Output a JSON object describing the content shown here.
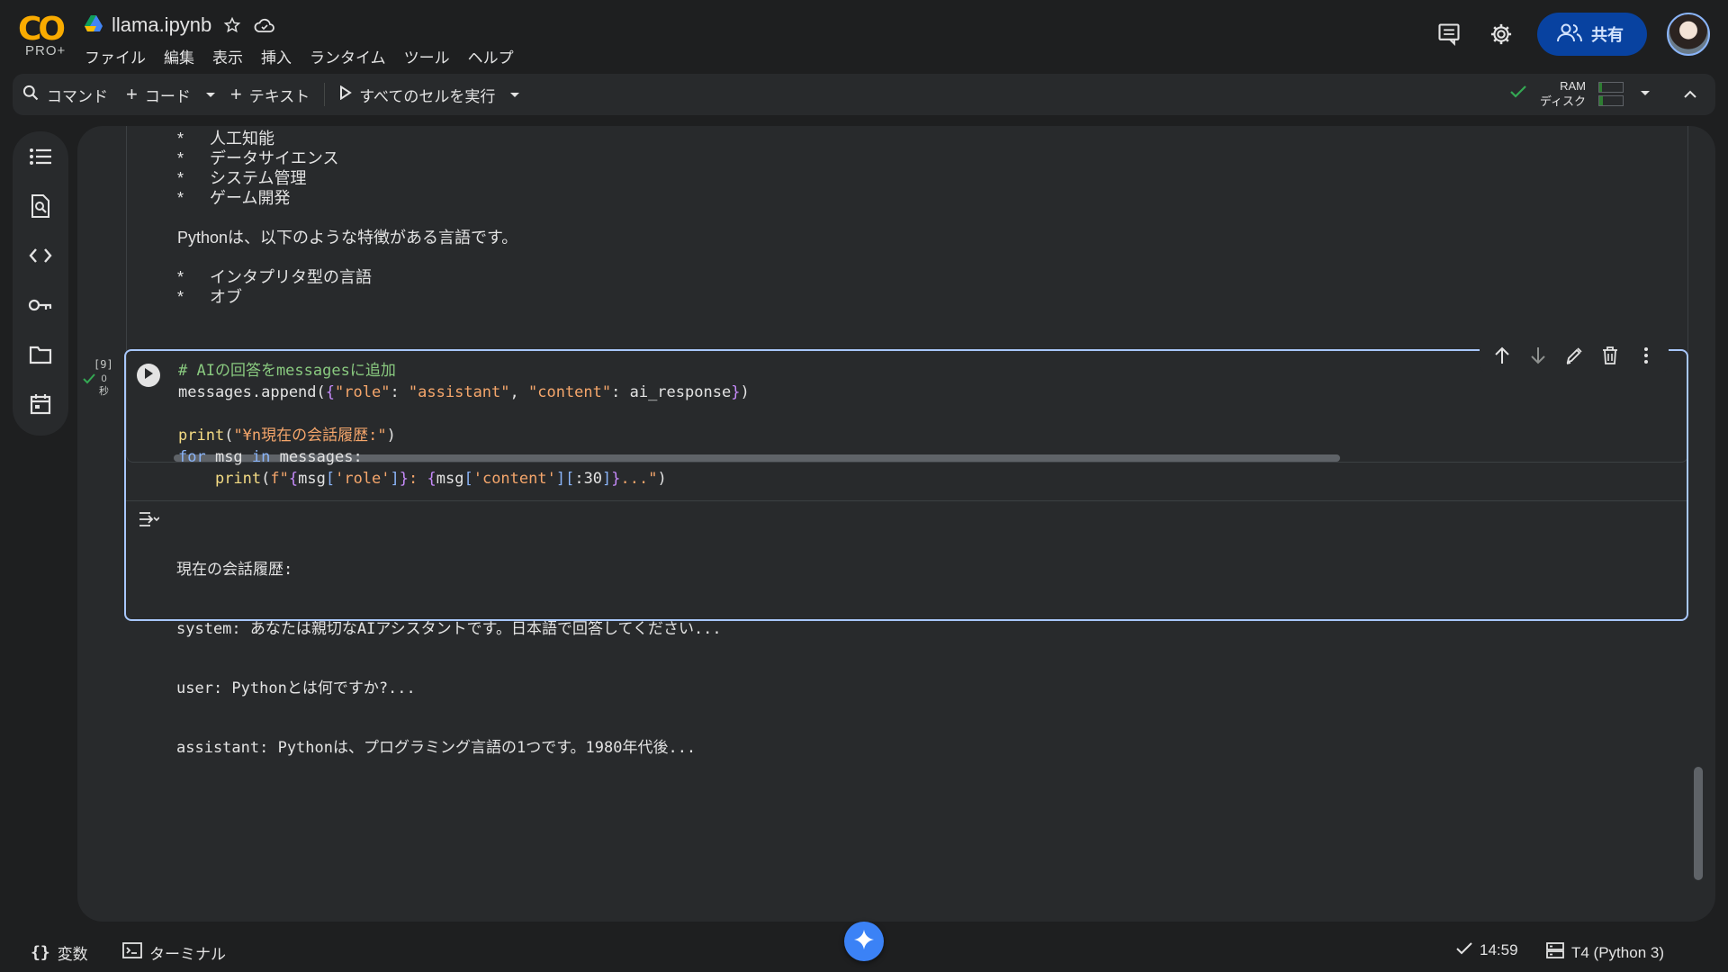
{
  "header": {
    "logo_text": "CO",
    "plan_label": "PRO+",
    "notebook_title": "llama.ipynb",
    "menu": [
      "ファイル",
      "編集",
      "表示",
      "挿入",
      "ランタイム",
      "ツール",
      "ヘルプ"
    ],
    "share_label": "共有"
  },
  "toolbar": {
    "command_label": "コマンド",
    "add_code_label": "コード",
    "add_text_label": "テキスト",
    "run_all_label": "すべてのセルを実行",
    "ram_label": "RAM",
    "disk_label": "ディスク",
    "ram_usage": 0.1,
    "disk_usage": 0.15
  },
  "sidebar": {
    "items": [
      "table-of-contents-icon",
      "find-replace-icon",
      "code-snippets-icon",
      "secrets-key-icon",
      "files-folder-icon",
      "calendar-icon"
    ]
  },
  "text_cell": {
    "bullets_top": [
      "人工知能",
      "データサイエンス",
      "システム管理",
      "ゲーム開発"
    ],
    "paragraph": "Pythonは、以下のような特徴がある言語です。",
    "bullets_bottom": [
      "インタプリタ型の言語",
      "オブ"
    ],
    "bullet_char": "*"
  },
  "code_cell": {
    "execution_count": "[9]",
    "exec_time_value": "0",
    "exec_time_unit": "秒",
    "output_lines": [
      "現在の会話履歴:",
      "system: あなたは親切なAIアシスタントです。日本語で回答してください...",
      "user: Pythonとは何ですか?...",
      "assistant: Pythonは、プログラミング言語の1つです。1980年代後..."
    ]
  },
  "footer": {
    "variables_label": "変数",
    "terminal_label": "ターミナル",
    "time": "14:59",
    "runtime": "T4 (Python 3)"
  },
  "colors": {
    "accent": "#a8c7fa",
    "share_bg": "#0842a0",
    "brand_orange": "#f9ab00",
    "status_green": "#34a853"
  }
}
